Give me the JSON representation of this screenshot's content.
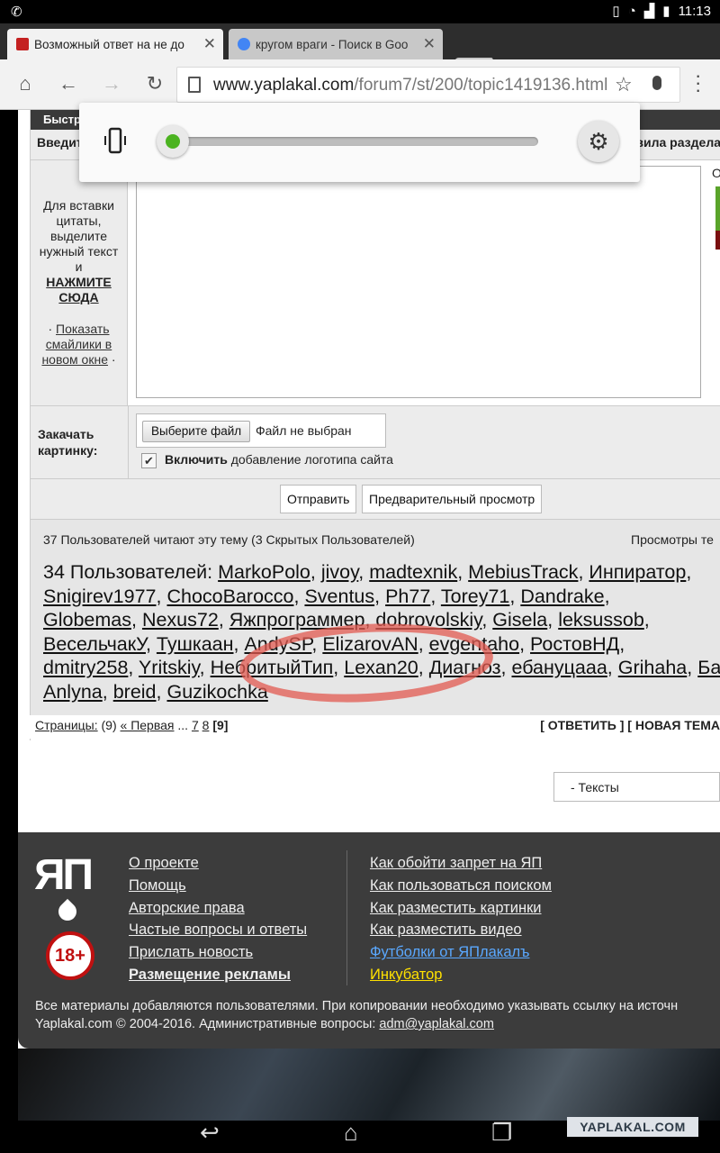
{
  "status_bar": {
    "time": "11:13"
  },
  "tabs": [
    {
      "title": "Возможный ответ на не до",
      "active": true
    },
    {
      "title": "кругом враги - Поиск в Goo",
      "active": false
    }
  ],
  "omnibox": {
    "url_host": "www.yaplakal.com",
    "url_path": "/forum7/st/200/topic1419136.html"
  },
  "form": {
    "header": "Быстр",
    "enter_label": "Введит",
    "rules_link": "вила раздела",
    "quote_hint": "Для вставки цитаты, выделите нужный текст и",
    "quote_click": "НАЖМИТЕ СЮДА",
    "smiles_link": "Показать смайлики в новом окне",
    "rating_label": "Оц",
    "upload_label": "Закачать картинку:",
    "file_button": "Выберите файл",
    "file_status": "Файл не выбран",
    "logo_checked": true,
    "logo_bold": "Включить",
    "logo_rest": "добавление логотипа сайта",
    "submit": "Отправить",
    "preview": "Предварительный просмотр"
  },
  "viewers": {
    "summary": "37 Пользователей читают эту тему (3 Скрытых Пользователей)",
    "views_label": "Просмотры те",
    "users_prefix": "34 Пользователей:",
    "users": [
      "MarkoPolo",
      "jivoy",
      "madtexnik",
      "MebiusTrack",
      "Инпиратор",
      "Snigirev1977",
      "ChocoBarocco",
      "Sventus",
      "Ph77",
      "Torey71",
      "Dandrake",
      "Globemas",
      "Nexus72",
      "Яжпрограммер",
      "dobrovolskiy",
      "Gisela",
      "leksussob",
      "ВесельчакУ",
      "Тушкаан",
      "AndySP",
      "ElizarovAN",
      "evgentaho",
      "РостовНД",
      "dmitry258",
      "Yritskiy",
      "НебритыйТип",
      "Lexan20",
      "Диагноз",
      "ебануцааа",
      "Grihaha",
      "БасманБай",
      "Anlyna",
      "breid",
      "Guzikochka"
    ]
  },
  "pager": {
    "label": "Страницы:",
    "count": "(9)",
    "first": "« Первая",
    "dots": "...",
    "p7": "7",
    "p8": "8",
    "current": "[9]",
    "actions": "[ ОТВЕТИТЬ ] [ НОВАЯ ТЕМА"
  },
  "select": {
    "value": "- Тексты"
  },
  "footer": {
    "logo": "ЯП",
    "age": "18+",
    "col1": [
      "О проекте",
      "Помощь",
      "Авторские права",
      "Частые вопросы и ответы",
      "Прислать новость",
      "Размещение рекламы"
    ],
    "col2": [
      "Как обойти запрет на ЯП",
      "Как пользоваться поиском",
      "Как разместить картинки",
      "Как разместить видео",
      "Футболки от ЯПлакалъ",
      "Инкубатор"
    ],
    "note1": "Все материалы добавляются пользователями. При копировании необходимо указывать ссылку на источн",
    "note2_prefix": "Yaplakal.com © 2004-2016. Административные вопросы:",
    "note2_email": "adm@yaplakal.com"
  },
  "watermark": "YAPLAKAL.COM",
  "colors": {
    "accent_green": "#4bb320",
    "scribble": "#e15a50",
    "footer_blue": "#5aa8ff",
    "footer_yellow": "#ffe000"
  },
  "volume": {
    "level": 0.0
  }
}
